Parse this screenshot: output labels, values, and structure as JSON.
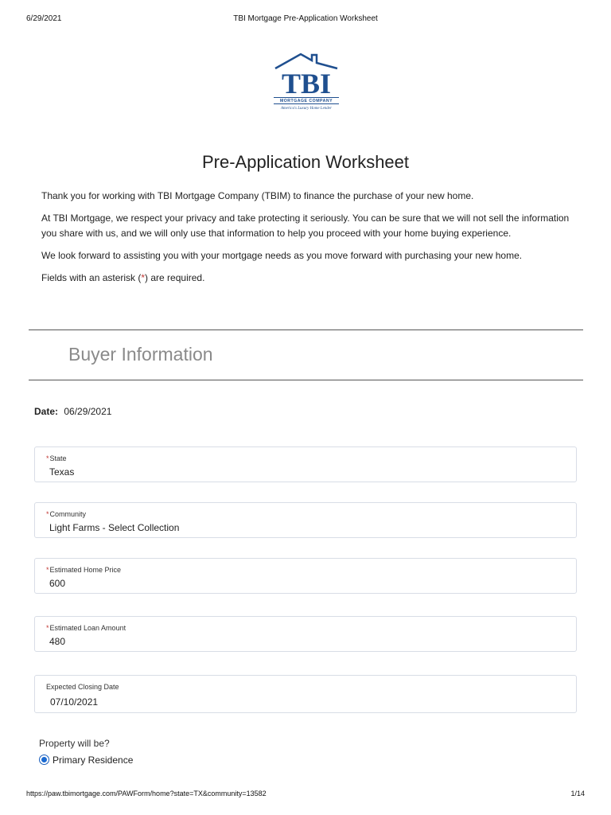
{
  "print_header": {
    "date": "6/29/2021",
    "title": "TBI Mortgage Pre-Application Worksheet"
  },
  "logo": {
    "brand_text": "TBI",
    "sub_text": "MORTGAGE COMPANY",
    "tagline": "America's Luxury Home Lender",
    "brand_color": "#1f4f8f"
  },
  "page_title": "Pre-Application Worksheet",
  "intro": {
    "p1": "Thank you for working with TBI Mortgage Company (TBIM) to finance the purchase of your new home.",
    "p2": "At TBI Mortgage, we respect your privacy and take protecting it seriously. You can be sure that we will not sell the information you share with us, and we will only use that information to help you proceed with your home buying experience.",
    "p3": "We look forward to assisting you with your mortgage needs as you move forward with purchasing your new home.",
    "p4_before": "Fields with an asterisk (",
    "p4_star": "*",
    "p4_after": ") are required."
  },
  "section_title": "Buyer Information",
  "date_row": {
    "label": "Date:",
    "value": "06/29/2021"
  },
  "fields": {
    "state": {
      "label": "State",
      "required_mark": "*",
      "value": "Texas"
    },
    "community": {
      "label": "Community",
      "required_mark": "*",
      "value": "Light Farms - Select Collection"
    },
    "home_price": {
      "label": "Estimated Home Price",
      "required_mark": "*",
      "value": "600"
    },
    "loan_amount": {
      "label": "Estimated Loan Amount",
      "required_mark": "*",
      "value": "480"
    },
    "closing_date": {
      "label": "Expected Closing Date",
      "value": "07/10/2021"
    }
  },
  "property": {
    "question": "Property will be?",
    "selected_option": "Primary Residence"
  },
  "print_footer": {
    "url": "https://paw.tbimortgage.com/PAWForm/home?state=TX&community=13582",
    "page": "1/14"
  },
  "colors": {
    "required": "#c23934",
    "radio": "#1b6ad1",
    "section_title": "#8a8a8a"
  }
}
